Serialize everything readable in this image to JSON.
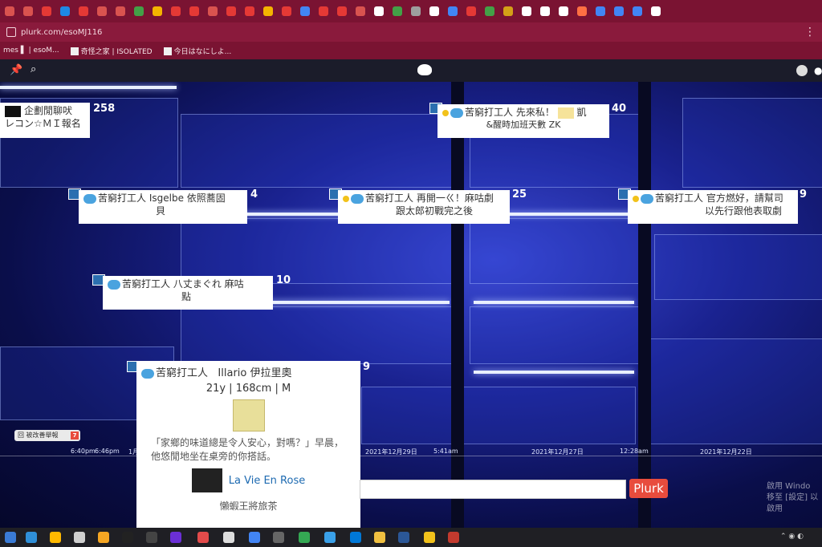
{
  "browser": {
    "url": "plurk.com/esoMJ116",
    "bookmarks": [
      "mes ▌ | esoM...",
      "奇怪之家 | ISOLATED",
      "今日はなにしよ..."
    ]
  },
  "tabs": [
    "#d9534f",
    "#d9534f",
    "#e53935",
    "#1e88e5",
    "#e53935",
    "#d9534f",
    "#d9534f",
    "#43a047",
    "#f4b400",
    "#e53935",
    "#e53935",
    "#d9534f",
    "#e53935",
    "#e53935",
    "#f4b400",
    "#e53935",
    "#4285f4",
    "#e53935",
    "#e53935",
    "#d9534f",
    "#ffffff",
    "#43a047",
    "#9e9e9e",
    "#ffffff",
    "#4285f4",
    "#e53935",
    "#43a047",
    "#d4a017",
    "#ffffff",
    "#ffffff",
    "#ffffff",
    "#ff7043",
    "#4285f4",
    "#4285f4",
    "#4285f4",
    "#ffffff"
  ],
  "cards": [
    {
      "id": "c1",
      "nick": "",
      "text": "企劃閒聊吠",
      "text2": "レコン☆ＭＩ報名",
      "count": "258"
    },
    {
      "id": "c2",
      "nick": "苦窮打工人",
      "text": "先來私！",
      "text2": "&醒時加班天數 ZK",
      "extra": "凱",
      "count": "40"
    },
    {
      "id": "c3",
      "nick": "苦窮打工人",
      "text": "Isgelbe 依照蕎固",
      "text2": "貝",
      "count": "4"
    },
    {
      "id": "c4",
      "nick": "苦窮打工人",
      "text": "再開一ㄍ！麻咕劇",
      "text2": "跟太郎初戰完之後",
      "count": "25"
    },
    {
      "id": "c5",
      "nick": "苦窮打工人",
      "text": "官方燃好，請幫司",
      "text2": "以先行跟他表取劇",
      "count": "9"
    },
    {
      "id": "c6",
      "nick": "苦窮打工人",
      "text": "八丈まぐれ 麻咕",
      "text2": "點",
      "count": "10"
    }
  ],
  "popup": {
    "nick": "苦窮打工人",
    "name": "Illario 伊拉里奧",
    "stats": "21y | 168cm | M",
    "bio": "「家鄉的味道總是令人安心，對嗎？」早晨，他悠閒地坐在桌旁的你搭話。",
    "song": "La Vie En Rose",
    "more": "懶蝦王將旅茶",
    "count": "9"
  },
  "timeline": [
    "6:40pm",
    "6:46pm",
    "1月",
    "2021年12月29日",
    "5:41am",
    "2021年12月27日",
    "12:28am",
    "2021年12月22日"
  ],
  "smallbtn": {
    "label": "回 被改善舉報",
    "badge": "7"
  },
  "plurk_button": "Plurk",
  "watermark": {
    "line1": "啟用 Windo",
    "line2": "移至 [設定] 以啟用"
  }
}
